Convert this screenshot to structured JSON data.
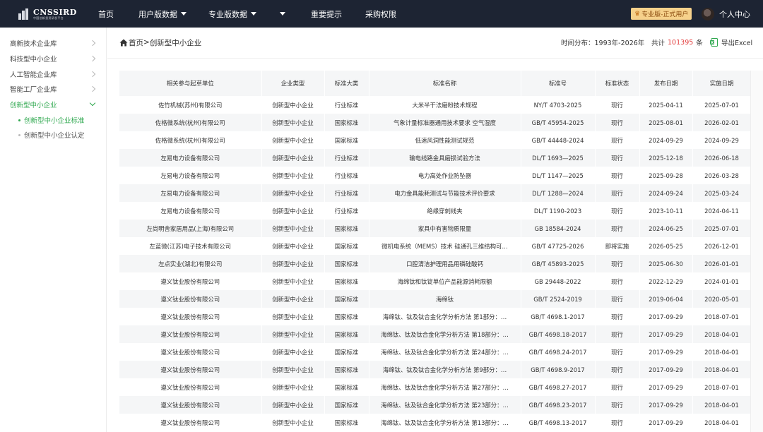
{
  "logo": {
    "name": "CNSSIRD",
    "subtitle": "中国创新投资研发平台"
  },
  "nav": {
    "items": [
      {
        "label": "首页",
        "dropdown": false
      },
      {
        "label": "用户版数据",
        "dropdown": true
      },
      {
        "label": "专业版数据",
        "dropdown": true
      },
      {
        "label": "",
        "dropdown": true
      },
      {
        "label": "重要提示",
        "dropdown": false
      },
      {
        "label": "采购权限",
        "dropdown": false
      }
    ],
    "badge": "专业版-正式用户",
    "user_label": "个人中心"
  },
  "sidebar": {
    "items": [
      {
        "label": "高新技术企业库",
        "expanded": false
      },
      {
        "label": "科技型中小企业",
        "expanded": false
      },
      {
        "label": "人工智能企业库",
        "expanded": false
      },
      {
        "label": "智能工厂企业库",
        "expanded": false
      },
      {
        "label": "创新型中小企业",
        "expanded": true
      }
    ],
    "subitems": [
      {
        "label": "创新型中小企业标准",
        "active": true
      },
      {
        "label": "创新型中小企业认定",
        "active": false
      }
    ]
  },
  "breadcrumb": {
    "home": "首页",
    "separator": ">",
    "current": "创新型中小企业"
  },
  "meta": {
    "time_label": "时间分布：1993年-2026年",
    "total_prefix": "共计",
    "total_count": "101395",
    "total_suffix": "条",
    "export_label": "导出Excel"
  },
  "table": {
    "columns": [
      "相关参与起草单位",
      "企业类型",
      "标准大类",
      "标准名称",
      "标准号",
      "标准状态",
      "发布日期",
      "实施日期"
    ],
    "rows": [
      [
        "佐竹机械(苏州)有限公司",
        "创新型中小企业",
        "行业标准",
        "大米半干法磨粉技术规程",
        "NY/T 4703-2025",
        "现行",
        "2025-04-11",
        "2025-07-01"
      ],
      [
        "佐格微系统(杭州)有限公司",
        "创新型中小企业",
        "国家标准",
        "气象计量标准器通用技术要求 空气湿度",
        "GB/T 45954-2025",
        "现行",
        "2025-08-01",
        "2026-02-01"
      ],
      [
        "佐格微系统(杭州)有限公司",
        "创新型中小企业",
        "国家标准",
        "低速风洞性能测试规范",
        "GB/T 44448-2024",
        "现行",
        "2024-09-29",
        "2024-09-29"
      ],
      [
        "左易电力设备有限公司",
        "创新型中小企业",
        "行业标准",
        "输电线路金具磨损试验方法",
        "DL/T 1693—2025",
        "现行",
        "2025-12-18",
        "2026-06-18"
      ],
      [
        "左易电力设备有限公司",
        "创新型中小企业",
        "行业标准",
        "电力高处作业防坠器",
        "DL/T 1147—2025",
        "现行",
        "2025-09-28",
        "2026-03-28"
      ],
      [
        "左易电力设备有限公司",
        "创新型中小企业",
        "行业标准",
        "电力金具能耗测试与节能技术评价要求",
        "DL/T 1288—2024",
        "现行",
        "2024-09-24",
        "2025-03-24"
      ],
      [
        "左易电力设备有限公司",
        "创新型中小企业",
        "行业标准",
        "绝缘穿刺线夹",
        "DL/T 1190-2023",
        "现行",
        "2023-10-11",
        "2024-04-11"
      ],
      [
        "左尚明舍家居用品(上海)有限公司",
        "创新型中小企业",
        "国家标准",
        "家具中有害物质限量",
        "GB 18584-2024",
        "现行",
        "2024-06-25",
        "2025-07-01"
      ],
      [
        "左蓝微(江苏)电子技术有限公司",
        "创新型中小企业",
        "国家标准",
        "微机电系统（MEMS）技术 硅通孔三维结构可…",
        "GB/T 47725-2026",
        "即将实施",
        "2026-05-25",
        "2026-12-01"
      ],
      [
        "左点实业(湖北)有限公司",
        "创新型中小企业",
        "国家标准",
        "口腔清洁护理用品用磷硅酸钙",
        "GB/T 45893-2025",
        "现行",
        "2025-06-30",
        "2026-01-01"
      ],
      [
        "遵义钛业股份有限公司",
        "创新型中小企业",
        "国家标准",
        "海绵钛和钛锭单位产品能源消耗限额",
        "GB 29448-2022",
        "现行",
        "2022-12-29",
        "2024-01-01"
      ],
      [
        "遵义钛业股份有限公司",
        "创新型中小企业",
        "国家标准",
        "海绵钛",
        "GB/T 2524-2019",
        "现行",
        "2019-06-04",
        "2020-05-01"
      ],
      [
        "遵义钛业股份有限公司",
        "创新型中小企业",
        "国家标准",
        "海绵钛、钛及钛合金化学分析方法 第1部分：…",
        "GB/T 4698.1-2017",
        "现行",
        "2017-09-29",
        "2018-07-01"
      ],
      [
        "遵义钛业股份有限公司",
        "创新型中小企业",
        "国家标准",
        "海绵钛、钛及钛合金化学分析方法 第18部分：…",
        "GB/T 4698.18-2017",
        "现行",
        "2017-09-29",
        "2018-04-01"
      ],
      [
        "遵义钛业股份有限公司",
        "创新型中小企业",
        "国家标准",
        "海绵钛、钛及钛合金化学分析方法 第24部分：…",
        "GB/T 4698.24-2017",
        "现行",
        "2017-09-29",
        "2018-04-01"
      ],
      [
        "遵义钛业股份有限公司",
        "创新型中小企业",
        "国家标准",
        "海绵钛、钛及钛合金化学分析方法 第9部分：…",
        "GB/T 4698.9-2017",
        "现行",
        "2017-09-29",
        "2018-04-01"
      ],
      [
        "遵义钛业股份有限公司",
        "创新型中小企业",
        "国家标准",
        "海绵钛、钛及钛合金化学分析方法 第27部分：…",
        "GB/T 4698.27-2017",
        "现行",
        "2017-09-29",
        "2018-07-01"
      ],
      [
        "遵义钛业股份有限公司",
        "创新型中小企业",
        "国家标准",
        "海绵钛、钛及钛合金化学分析方法 第23部分：…",
        "GB/T 4698.23-2017",
        "现行",
        "2017-09-29",
        "2018-04-01"
      ],
      [
        "遵义钛业股份有限公司",
        "创新型中小企业",
        "国家标准",
        "海绵钛、钛及钛合金化学分析方法 第13部分：…",
        "GB/T 4698.13-2017",
        "现行",
        "2017-09-29",
        "2018-04-01"
      ]
    ]
  },
  "colors": {
    "topbar": "#1d2433",
    "accent_green": "#2fa84f",
    "count_red": "#e23b3b",
    "badge_gold": "#f6d18b"
  }
}
